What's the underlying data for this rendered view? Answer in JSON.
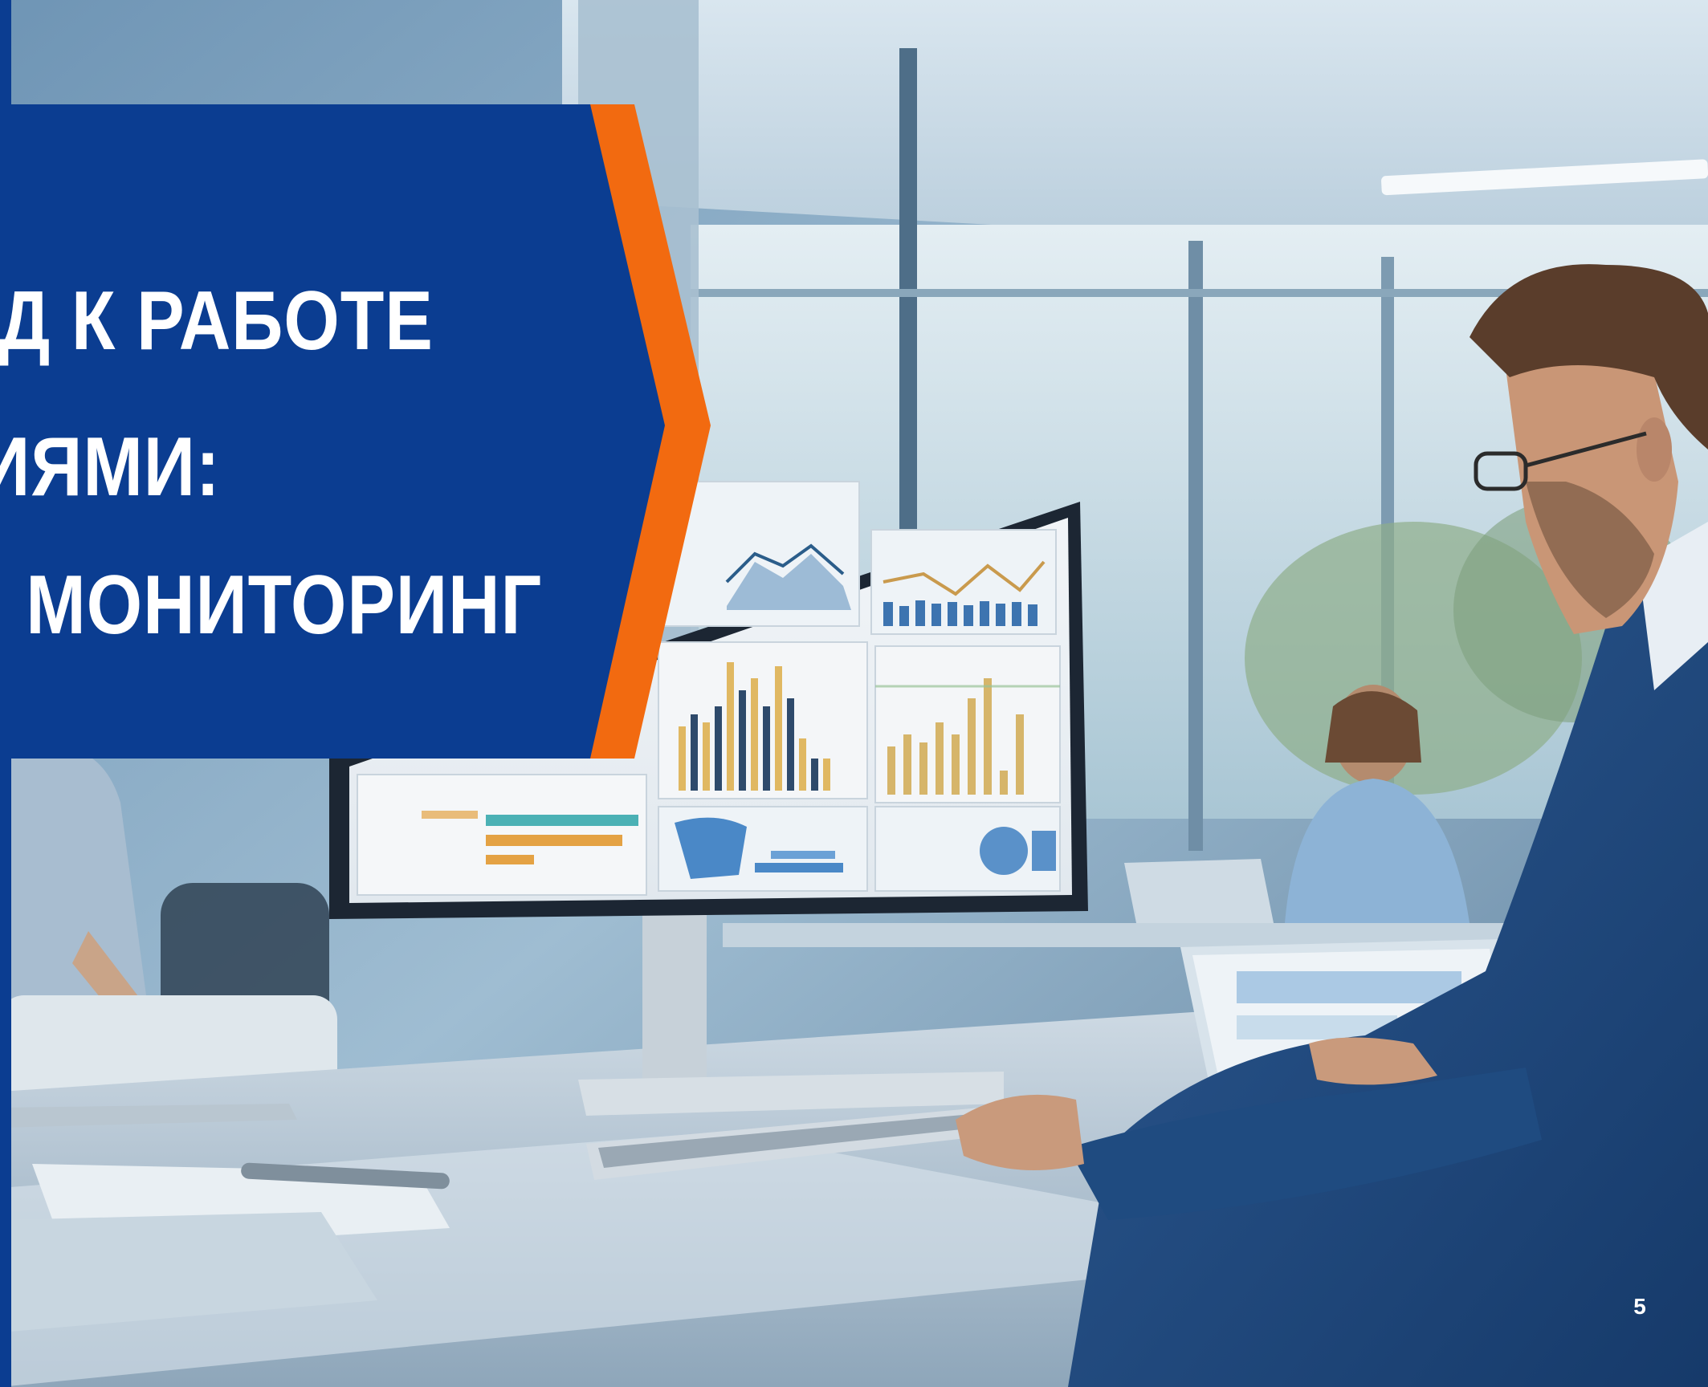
{
  "slide": {
    "title_lines": [
      "ОД К РАБОТЕ",
      "ИЯМИ:",
      "Й МОНИТОРИНГ"
    ],
    "page_number": "5"
  },
  "colors": {
    "brand_blue": "#0b3d91",
    "accent_orange": "#f26a10",
    "text": "#ffffff"
  }
}
